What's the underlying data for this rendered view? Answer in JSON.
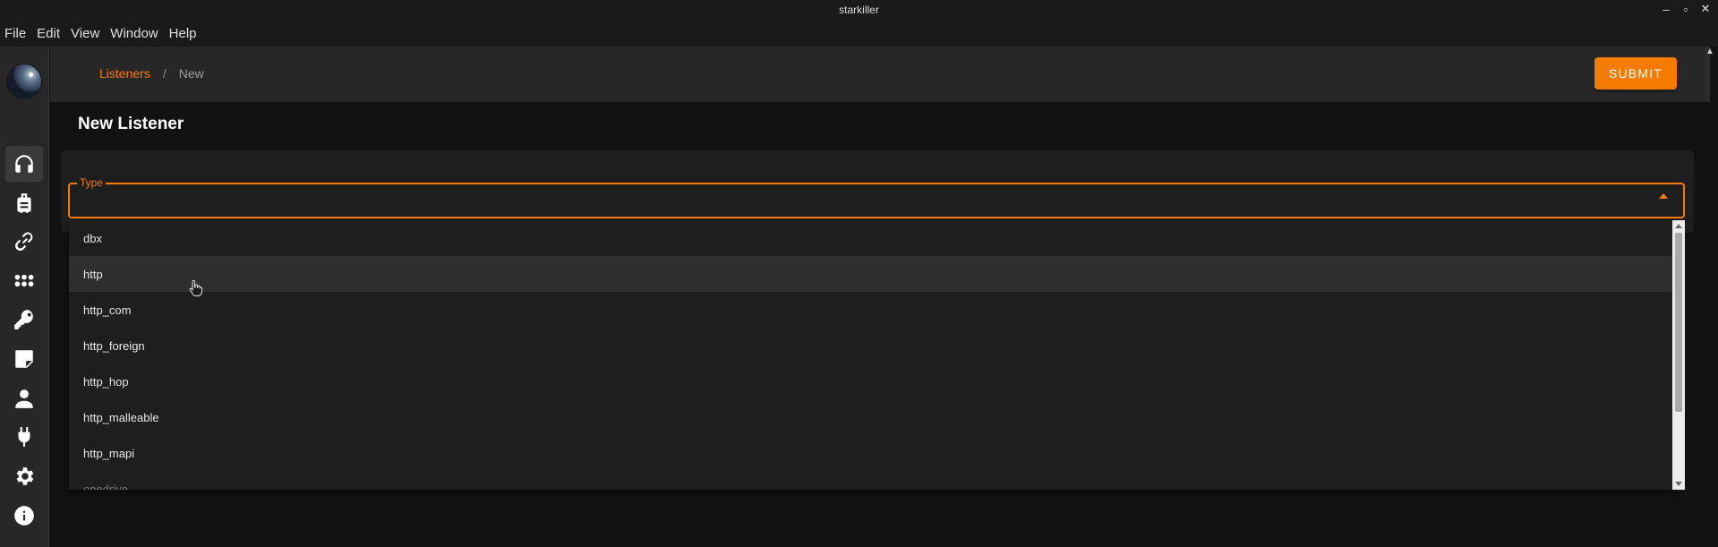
{
  "window": {
    "title": "starkiller"
  },
  "menubar": {
    "items": [
      "File",
      "Edit",
      "View",
      "Window",
      "Help"
    ]
  },
  "breadcrumb": {
    "parent": "Listeners",
    "separator": "/",
    "current": "New"
  },
  "actions": {
    "submit_label": "SUBMIT"
  },
  "page": {
    "title": "New Listener"
  },
  "type_field": {
    "label": "Type",
    "value": ""
  },
  "dropdown": {
    "options": [
      "dbx",
      "http",
      "http_com",
      "http_foreign",
      "http_hop",
      "http_malleable",
      "http_mapi",
      "onedrive"
    ],
    "hovered": "http"
  },
  "nav": {
    "items": [
      {
        "name": "listeners",
        "icon": "headphones-icon",
        "active": true
      },
      {
        "name": "stagers",
        "icon": "luggage-icon",
        "active": false
      },
      {
        "name": "agents",
        "icon": "link-icon",
        "active": false
      },
      {
        "name": "modules",
        "icon": "apps-icon",
        "active": false
      },
      {
        "name": "credentials",
        "icon": "key-icon",
        "active": false
      },
      {
        "name": "reporting",
        "icon": "note-icon",
        "active": false
      },
      {
        "name": "users",
        "icon": "person-icon",
        "active": false
      },
      {
        "name": "plugins",
        "icon": "plug-icon",
        "active": false
      },
      {
        "name": "settings",
        "icon": "gear-icon",
        "active": false
      },
      {
        "name": "about",
        "icon": "info-icon",
        "active": false
      }
    ]
  },
  "colors": {
    "accent": "#f57c00",
    "background": "#121212",
    "surface": "#272727"
  }
}
